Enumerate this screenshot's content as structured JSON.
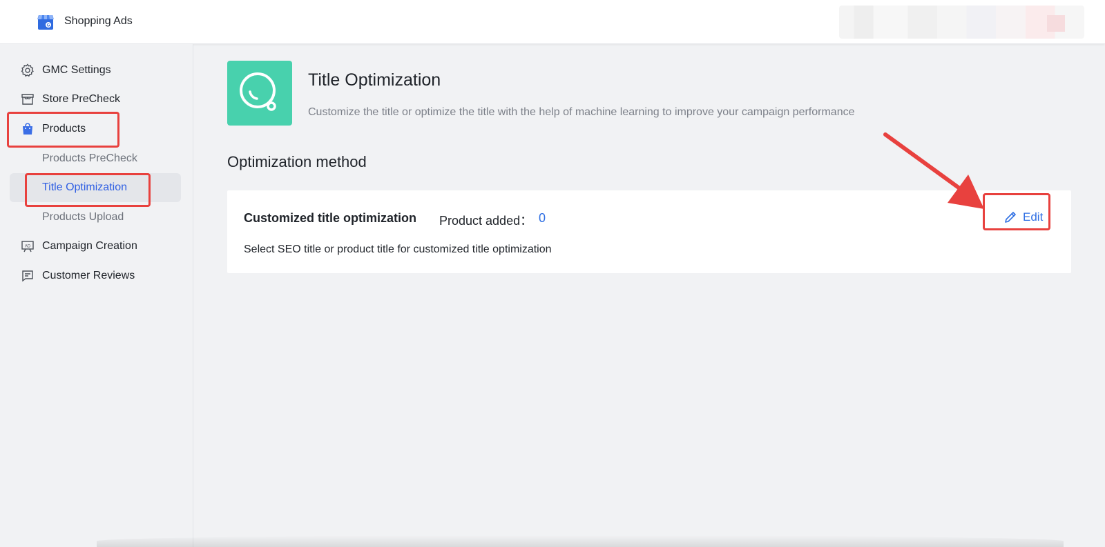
{
  "app": {
    "name": "Shopping Ads",
    "logo_icon": "store-g-logo-icon"
  },
  "sidebar": {
    "items": [
      {
        "label": "GMC Settings",
        "icon": "gear-icon"
      },
      {
        "label": "Store PreCheck",
        "icon": "store-icon"
      },
      {
        "label": "Products",
        "icon": "shopping-bag-icon"
      },
      {
        "label": "Products PreCheck"
      },
      {
        "label": "Title Optimization"
      },
      {
        "label": "Products Upload"
      },
      {
        "label": "Campaign Creation",
        "icon": "ad-board-icon"
      },
      {
        "label": "Customer Reviews",
        "icon": "review-icon"
      }
    ],
    "active": "Title Optimization"
  },
  "page": {
    "title": "Title Optimization",
    "description": "Customize the title or optimize the title with the help of machine learning to improve your campaign performance",
    "icon": "search-icon",
    "icon_bg": "#48d1ad"
  },
  "section": {
    "title": "Optimization method"
  },
  "card": {
    "title": "Customized title optimization",
    "product_label": "Product added：",
    "product_count": "0",
    "description": "Select SEO title or product title for customized title optimization",
    "edit_label": "Edit",
    "edit_icon": "pencil-icon"
  },
  "colors": {
    "accent": "#2f6fe3",
    "active_nav": "#2f5fe3",
    "annotation": "#e8413e"
  }
}
